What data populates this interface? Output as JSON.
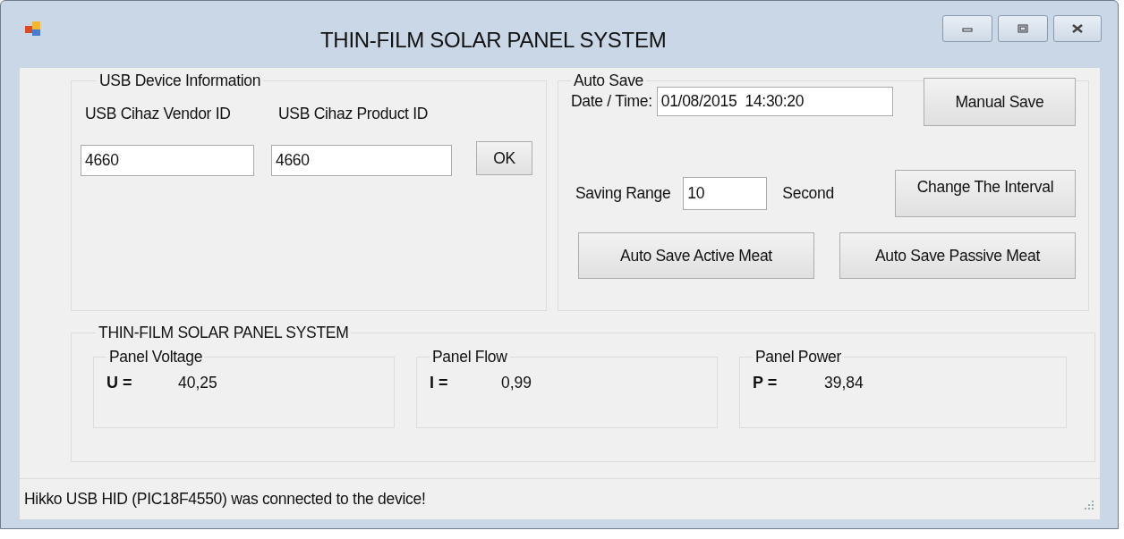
{
  "window": {
    "title": "THIN-FILM SOLAR PANEL SYSTEM"
  },
  "usb_group": {
    "title": "USB Device Information",
    "vendor_label": "USB Cihaz Vendor ID",
    "product_label": "USB Cihaz Product ID",
    "vendor_value": "4660",
    "product_value": "4660",
    "ok_button": "OK"
  },
  "auto_save": {
    "title": "Auto Save",
    "date_label": "Date / Time:",
    "date_value": "01/08/2015  14:30:20",
    "manual_button": "Manual Save",
    "range_label": "Saving Range",
    "range_value": "10",
    "range_unit": "Second",
    "interval_button": "Change The Interval",
    "active_button": "Auto Save Active Meat",
    "passive_button": "Auto Save Passive Meat"
  },
  "system_group": {
    "title": "THIN-FILM SOLAR PANEL SYSTEM",
    "readings": [
      {
        "title": "Panel Voltage",
        "symbol": "U =",
        "value": "40,25"
      },
      {
        "title": "Panel Flow",
        "symbol": "I =",
        "value": "0,99"
      },
      {
        "title": "Panel Power",
        "symbol": "P =",
        "value": "39,84"
      }
    ]
  },
  "status_bar": {
    "message": "Hikko USB HID (PIC18F4550) was connected to the device!"
  }
}
